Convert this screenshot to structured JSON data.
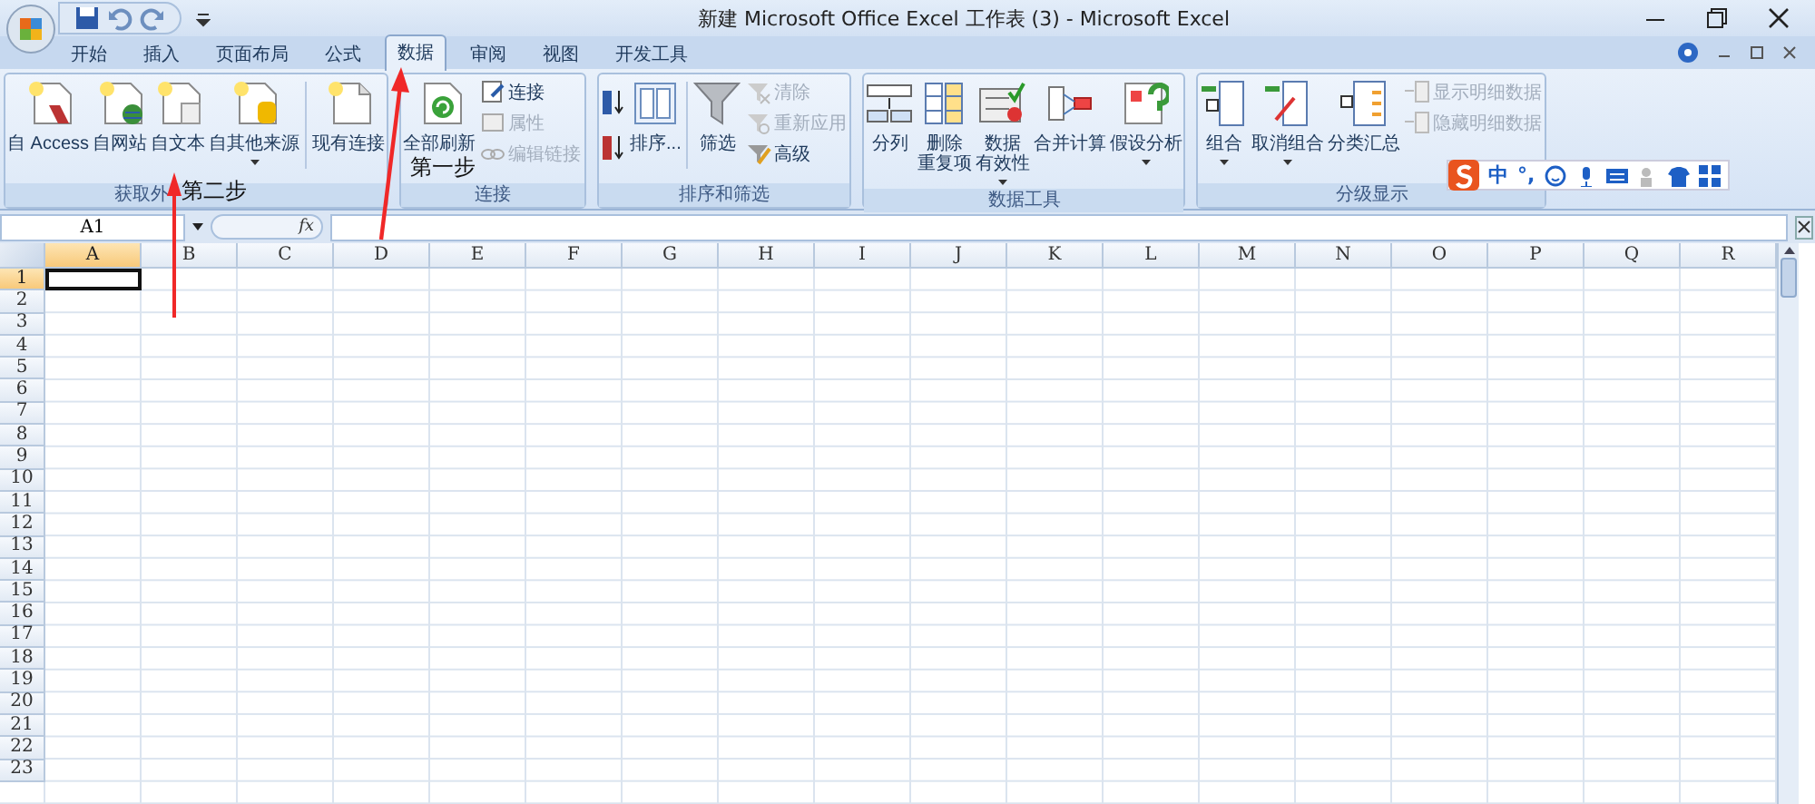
{
  "window": {
    "title": "新建 Microsoft Office Excel 工作表 (3) - Microsoft Excel"
  },
  "tabs": [
    {
      "label": "开始",
      "selected": false
    },
    {
      "label": "插入",
      "selected": false
    },
    {
      "label": "页面布局",
      "selected": false
    },
    {
      "label": "公式",
      "selected": false
    },
    {
      "label": "数据",
      "selected": true
    },
    {
      "label": "审阅",
      "selected": false
    },
    {
      "label": "视图",
      "selected": false
    },
    {
      "label": "开发工具",
      "selected": false
    }
  ],
  "ribbon": {
    "groups": [
      {
        "label": "获取外",
        "items": [
          {
            "kind": "large",
            "label": "自 Access",
            "disabled": false,
            "dropdown": false
          },
          {
            "kind": "large",
            "label": "自网站",
            "disabled": false,
            "dropdown": false
          },
          {
            "kind": "large",
            "label": "自文本",
            "disabled": false,
            "dropdown": false
          },
          {
            "kind": "large",
            "label": "自其他来源",
            "disabled": false,
            "dropdown": true
          },
          {
            "kind": "separator"
          },
          {
            "kind": "large",
            "label": "现有连接",
            "disabled": false,
            "dropdown": false
          }
        ]
      },
      {
        "label": "连接",
        "items": [
          {
            "kind": "large",
            "label": "全部刷新",
            "disabled": false,
            "dropdown": false
          },
          {
            "kind": "smallstack",
            "items": [
              {
                "label": "连接",
                "disabled": false
              },
              {
                "label": "属性",
                "disabled": true
              },
              {
                "label": "编辑链接",
                "disabled": true
              }
            ]
          }
        ]
      },
      {
        "label": "排序和筛选",
        "items": [
          {
            "kind": "iconstack"
          },
          {
            "kind": "large",
            "label": "排序...",
            "disabled": false,
            "dropdown": false
          },
          {
            "kind": "separator"
          },
          {
            "kind": "large",
            "label": "筛选",
            "disabled": false,
            "dropdown": false
          },
          {
            "kind": "smallstack",
            "items": [
              {
                "label": "清除",
                "disabled": true
              },
              {
                "label": "重新应用",
                "disabled": true
              },
              {
                "label": "高级",
                "disabled": false
              }
            ]
          }
        ]
      },
      {
        "label": "数据工具",
        "items": [
          {
            "kind": "large",
            "label": "分列",
            "disabled": false,
            "dropdown": false
          },
          {
            "kind": "large",
            "label": "删除",
            "second_line": "重复项",
            "disabled": false,
            "dropdown": false
          },
          {
            "kind": "large",
            "label": "数据",
            "second_line": "有效性",
            "disabled": false,
            "dropdown": true
          },
          {
            "kind": "large",
            "label": "合并计算",
            "disabled": false,
            "dropdown": false
          },
          {
            "kind": "large",
            "label": "假设分析",
            "disabled": false,
            "dropdown": true
          }
        ]
      },
      {
        "label": "分级显示",
        "items": [
          {
            "kind": "large",
            "label": "组合",
            "disabled": false,
            "dropdown": true
          },
          {
            "kind": "large",
            "label": "取消组合",
            "disabled": false,
            "dropdown": true
          },
          {
            "kind": "large",
            "label": "分类汇总",
            "disabled": false,
            "dropdown": false
          },
          {
            "kind": "smallstack",
            "items": [
              {
                "label": "显示明细数据",
                "disabled": true
              },
              {
                "label": "隐藏明细数据",
                "disabled": true
              }
            ]
          }
        ]
      }
    ]
  },
  "formula_bar": {
    "name_box": "A1",
    "function_label": "fx"
  },
  "sheet": {
    "columns": [
      {
        "label": "A",
        "selected": true
      },
      {
        "label": "B",
        "selected": false
      },
      {
        "label": "C",
        "selected": false
      },
      {
        "label": "D",
        "selected": false
      },
      {
        "label": "E",
        "selected": false
      },
      {
        "label": "F",
        "selected": false
      },
      {
        "label": "G",
        "selected": false
      },
      {
        "label": "H",
        "selected": false
      },
      {
        "label": "I",
        "selected": false
      },
      {
        "label": "J",
        "selected": false
      },
      {
        "label": "K",
        "selected": false
      },
      {
        "label": "L",
        "selected": false
      },
      {
        "label": "M",
        "selected": false
      },
      {
        "label": "N",
        "selected": false
      },
      {
        "label": "O",
        "selected": false
      },
      {
        "label": "P",
        "selected": false
      },
      {
        "label": "Q",
        "selected": false
      },
      {
        "label": "R",
        "selected": false
      }
    ],
    "rows": [
      {
        "label": "1",
        "selected": true
      },
      {
        "label": "2",
        "selected": false
      },
      {
        "label": "3",
        "selected": false
      },
      {
        "label": "4",
        "selected": false
      },
      {
        "label": "5",
        "selected": false
      },
      {
        "label": "6",
        "selected": false
      },
      {
        "label": "7",
        "selected": false
      },
      {
        "label": "8",
        "selected": false
      },
      {
        "label": "9",
        "selected": false
      },
      {
        "label": "10",
        "selected": false
      },
      {
        "label": "11",
        "selected": false
      },
      {
        "label": "12",
        "selected": false
      },
      {
        "label": "13",
        "selected": false
      },
      {
        "label": "14",
        "selected": false
      },
      {
        "label": "15",
        "selected": false
      },
      {
        "label": "16",
        "selected": false
      },
      {
        "label": "17",
        "selected": false
      },
      {
        "label": "18",
        "selected": false
      },
      {
        "label": "19",
        "selected": false
      },
      {
        "label": "20",
        "selected": false
      },
      {
        "label": "21",
        "selected": false
      },
      {
        "label": "22",
        "selected": false
      },
      {
        "label": "23",
        "selected": false
      }
    ]
  },
  "ime_toolbar": {
    "mode": "中",
    "punctuation": "°,"
  },
  "annotations": [
    {
      "text": "第一步"
    },
    {
      "text": "第二步"
    }
  ]
}
